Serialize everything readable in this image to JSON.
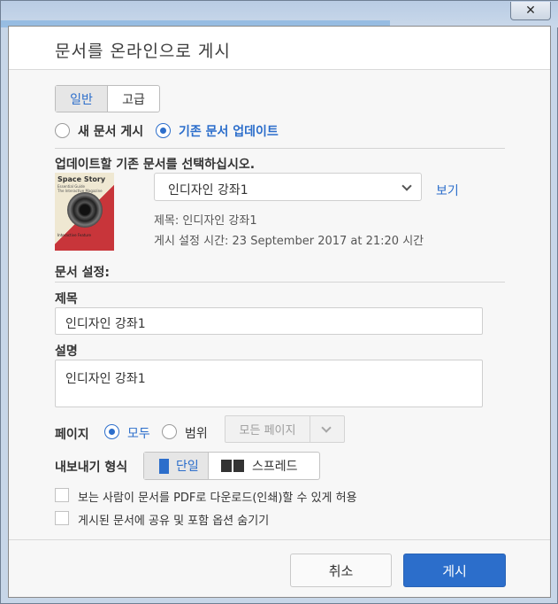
{
  "window": {
    "close_glyph": "✕"
  },
  "dialog": {
    "title": "문서를 온라인으로 게시"
  },
  "tabs": [
    {
      "label": "일반"
    },
    {
      "label": "고급"
    }
  ],
  "publish_mode": {
    "options": [
      {
        "label": "새 문서 게시"
      },
      {
        "label": "기존 문서 업데이트"
      }
    ],
    "selected": "기존 문서 업데이트"
  },
  "existing": {
    "heading": "업데이트할 기존 문서를 선택하십시오.",
    "cover": {
      "title": "Space Story",
      "subtitle": "Essential Guide",
      "tagline": "The Interactive Magazine",
      "footer": "Interactive Feature"
    },
    "selected_document": "인디자인 강좌1",
    "view_link": "보기",
    "title_line": "제목: 인디자인 강좌1",
    "published_line": "게시 설정 시간: 23 September 2017 at 21:20 시간"
  },
  "settings": {
    "heading": "문서 설정:",
    "title_label": "제목",
    "title_value": "인디자인 강좌1",
    "desc_label": "설명",
    "desc_value": "인디자인 강좌1"
  },
  "pages": {
    "label": "페이지",
    "all_label": "모두",
    "range_label": "범위",
    "selected": "모두",
    "range_dropdown": "모든 페이지"
  },
  "export": {
    "label": "내보내기 형식",
    "single": "단일",
    "spread": "스프레드",
    "selected": "단일"
  },
  "options": {
    "allow_download": "보는 사람이 문서를 PDF로 다운로드(인쇄)할 수 있게 허용",
    "allow_download_checked": false,
    "hide_share": "게시된 문서에 공유 및 포함 옵션 숨기기",
    "hide_share_checked": false
  },
  "buttons": {
    "cancel": "취소",
    "publish": "게시"
  },
  "colors": {
    "accent": "#2c6ecb"
  }
}
